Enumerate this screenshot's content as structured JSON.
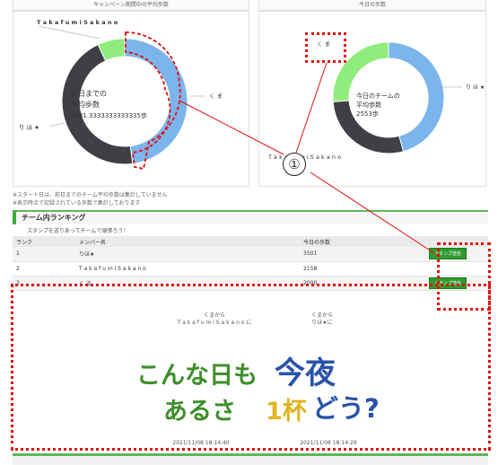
{
  "headers": {
    "left": "キャンペーン期間中の平均歩数",
    "right": "今日の歩数"
  },
  "left_chart": {
    "top_label": "T a k a f u m i S a k a n o",
    "right_label": "く ま",
    "left_label": "り ほ ★",
    "center_line1": "前日までの",
    "center_line2": "平均歩数",
    "center_line3": "3931.3333333333335歩",
    "segments": [
      {
        "name": "くま",
        "fraction": 0.48,
        "color": "#7cb5ec"
      },
      {
        "name": "りほ★",
        "fraction": 0.45,
        "color": "#3f3f46"
      },
      {
        "name": "TakafumiSakano",
        "fraction": 0.07,
        "color": "#90ed7d"
      }
    ]
  },
  "right_chart": {
    "top_label": "く ま",
    "right_label": "り ほ ★",
    "bottom_label": "T a k a f u m i S a k a n o",
    "center_line1": "今日のチームの",
    "center_line2": "平均歩数",
    "center_line3": "2553歩",
    "segments": [
      {
        "name": "りほ★",
        "fraction": 0.457,
        "color": "#7cb5ec"
      },
      {
        "name": "TakafumiSakano",
        "fraction": 0.282,
        "color": "#3f3f46"
      },
      {
        "name": "くま",
        "fraction": 0.261,
        "color": "#90ed7d"
      }
    ]
  },
  "notes": {
    "line1": "※スタート日は、前日までのチーム平均歩数は集計していません",
    "line2": "※表示時点で記録されている歩数で集計しております"
  },
  "ranking": {
    "title": "チーム内ランキング",
    "subtitle": "スタンプを送りあってチームで頑張ろう！",
    "columns": [
      "ランク",
      "メンバー名",
      "今日の歩数"
    ],
    "rows": [
      {
        "rank": "1",
        "name": "りほ★",
        "steps": "3501",
        "button": "スタンプ送信"
      },
      {
        "rank": "2",
        "name": "T a k a f u m i S a k a n o",
        "steps": "2158",
        "button": ""
      },
      {
        "rank": "3",
        "name": "く ま",
        "steps": "2000",
        "button": "スタンプ送信"
      }
    ]
  },
  "stamps": [
    {
      "from": "くまから",
      "to": "T a k a f u m i S a k a n o に",
      "line1": "こんな日も",
      "line2": "あるさ",
      "date": "2021/11/08 18:14:40"
    },
    {
      "from": "くまから",
      "to": "りほ★に",
      "line1": "今夜",
      "line2_a": "1杯",
      "line2_b": "どう?",
      "date": "2021/11/08 18:14:29"
    }
  ],
  "annotation": {
    "number": "①"
  }
}
